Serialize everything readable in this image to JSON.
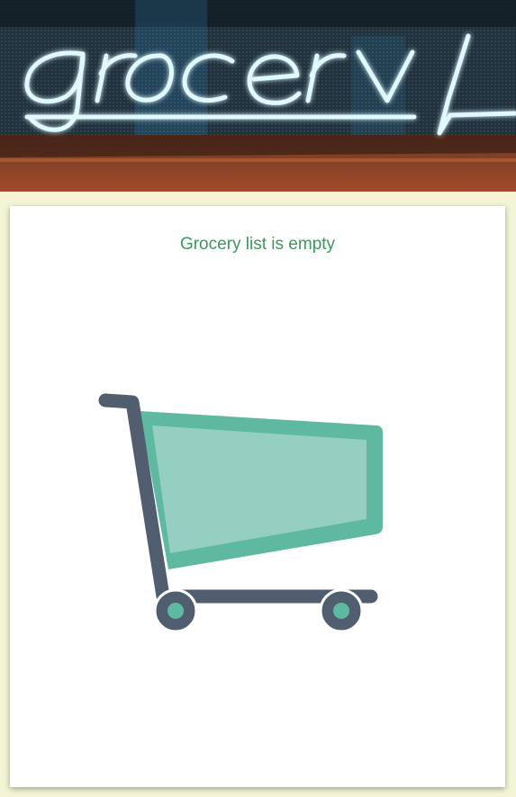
{
  "header": {
    "banner_image": "grocery-neon-sign",
    "neon_word": "grocery"
  },
  "list": {
    "empty_message": "Grocery list is empty",
    "illustration": "shopping-cart-icon"
  },
  "colors": {
    "page_background": "#f4f5d6",
    "message_text": "#3a9a5b",
    "cart_basket": "#5fb8a0",
    "cart_basket_inner": "#94cfc1",
    "cart_frame": "#505e70",
    "neon": "#dff9ff"
  }
}
